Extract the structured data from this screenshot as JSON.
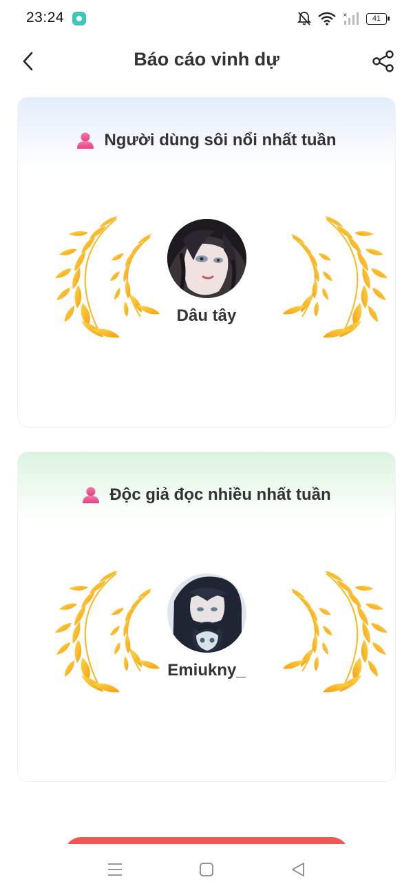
{
  "status_bar": {
    "time": "23:24",
    "battery": "41",
    "icons": [
      "app-notification-icon",
      "mute-bell-icon",
      "wifi-icon",
      "signal-icon",
      "battery-icon"
    ]
  },
  "header": {
    "title": "Báo cáo vinh dự",
    "back_icon": "chevron-left-icon",
    "share_icon": "share-icon"
  },
  "cards": [
    {
      "title": "Người dùng sôi nổi nhất tuần",
      "title_icon": "user-icon",
      "username": "Dâu tây",
      "accent": "#e3edfb"
    },
    {
      "title": "Độc giả đọc nhiều nhất tuần",
      "title_icon": "user-icon",
      "username": "Emiukny_",
      "accent": "#dcf4df"
    }
  ],
  "colors": {
    "laurel_light": "#ffd54a",
    "laurel_dark": "#f5a00f",
    "user_icon": "#e8498c",
    "bottom_button": "#f25555"
  },
  "nav_bar": {
    "icons": [
      "menu-icon",
      "home-square-icon",
      "back-triangle-icon"
    ]
  }
}
